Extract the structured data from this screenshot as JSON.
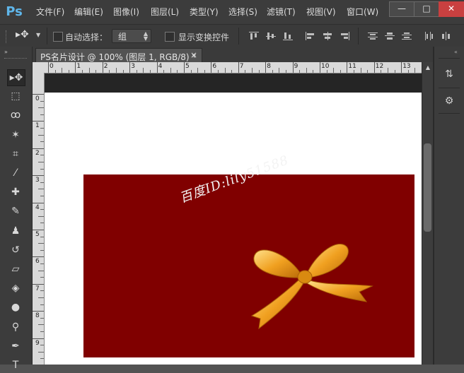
{
  "app": {
    "logo": "Ps"
  },
  "menu": [
    "文件(F)",
    "编辑(E)",
    "图像(I)",
    "图层(L)",
    "类型(Y)",
    "选择(S)",
    "滤镜(T)",
    "视图(V)",
    "窗口(W)"
  ],
  "window_controls": {
    "minimize": "—",
    "maximize": "□",
    "close": "✕"
  },
  "options_bar": {
    "auto_select_label": "自动选择：",
    "auto_select_value": "组",
    "show_transform_label": "显示变换控件"
  },
  "document": {
    "tab_title": "PS名片设计 @ 100% (图层 1, RGB/8) *",
    "tab_close": "×"
  },
  "ruler": {
    "top": [
      "0",
      "1",
      "2",
      "3",
      "4",
      "5",
      "6",
      "7",
      "8",
      "9",
      "10",
      "11",
      "12",
      "13"
    ],
    "left": [
      "0",
      "1",
      "2",
      "3",
      "4",
      "5",
      "6",
      "7",
      "8",
      "9"
    ]
  },
  "canvas": {
    "card_color": "#800000",
    "watermark": "百度ID:lily51588",
    "bow_color": "#f0a020"
  },
  "tools": [
    {
      "name": "move-tool",
      "glyph": "▸✥"
    },
    {
      "name": "marquee-tool",
      "glyph": "⬚"
    },
    {
      "name": "lasso-tool",
      "glyph": "ꝏ"
    },
    {
      "name": "magic-wand-tool",
      "glyph": "✶"
    },
    {
      "name": "crop-tool",
      "glyph": "⌗"
    },
    {
      "name": "eyedropper-tool",
      "glyph": "⁄"
    },
    {
      "name": "healing-brush-tool",
      "glyph": "✚"
    },
    {
      "name": "brush-tool",
      "glyph": "✎"
    },
    {
      "name": "clone-stamp-tool",
      "glyph": "♟"
    },
    {
      "name": "history-brush-tool",
      "glyph": "↺"
    },
    {
      "name": "eraser-tool",
      "glyph": "▱"
    },
    {
      "name": "paint-bucket-tool",
      "glyph": "◈"
    },
    {
      "name": "blur-tool",
      "glyph": "●"
    },
    {
      "name": "dodge-tool",
      "glyph": "⚲"
    },
    {
      "name": "pen-tool",
      "glyph": "✒"
    },
    {
      "name": "type-tool",
      "glyph": "T"
    }
  ],
  "right_panel": [
    "⇅",
    "⚙"
  ],
  "colors": {
    "menubar": "#3c3c3c",
    "panel": "#3c3c3c",
    "workspace": "#535353",
    "logo": "#5fb6ea"
  }
}
